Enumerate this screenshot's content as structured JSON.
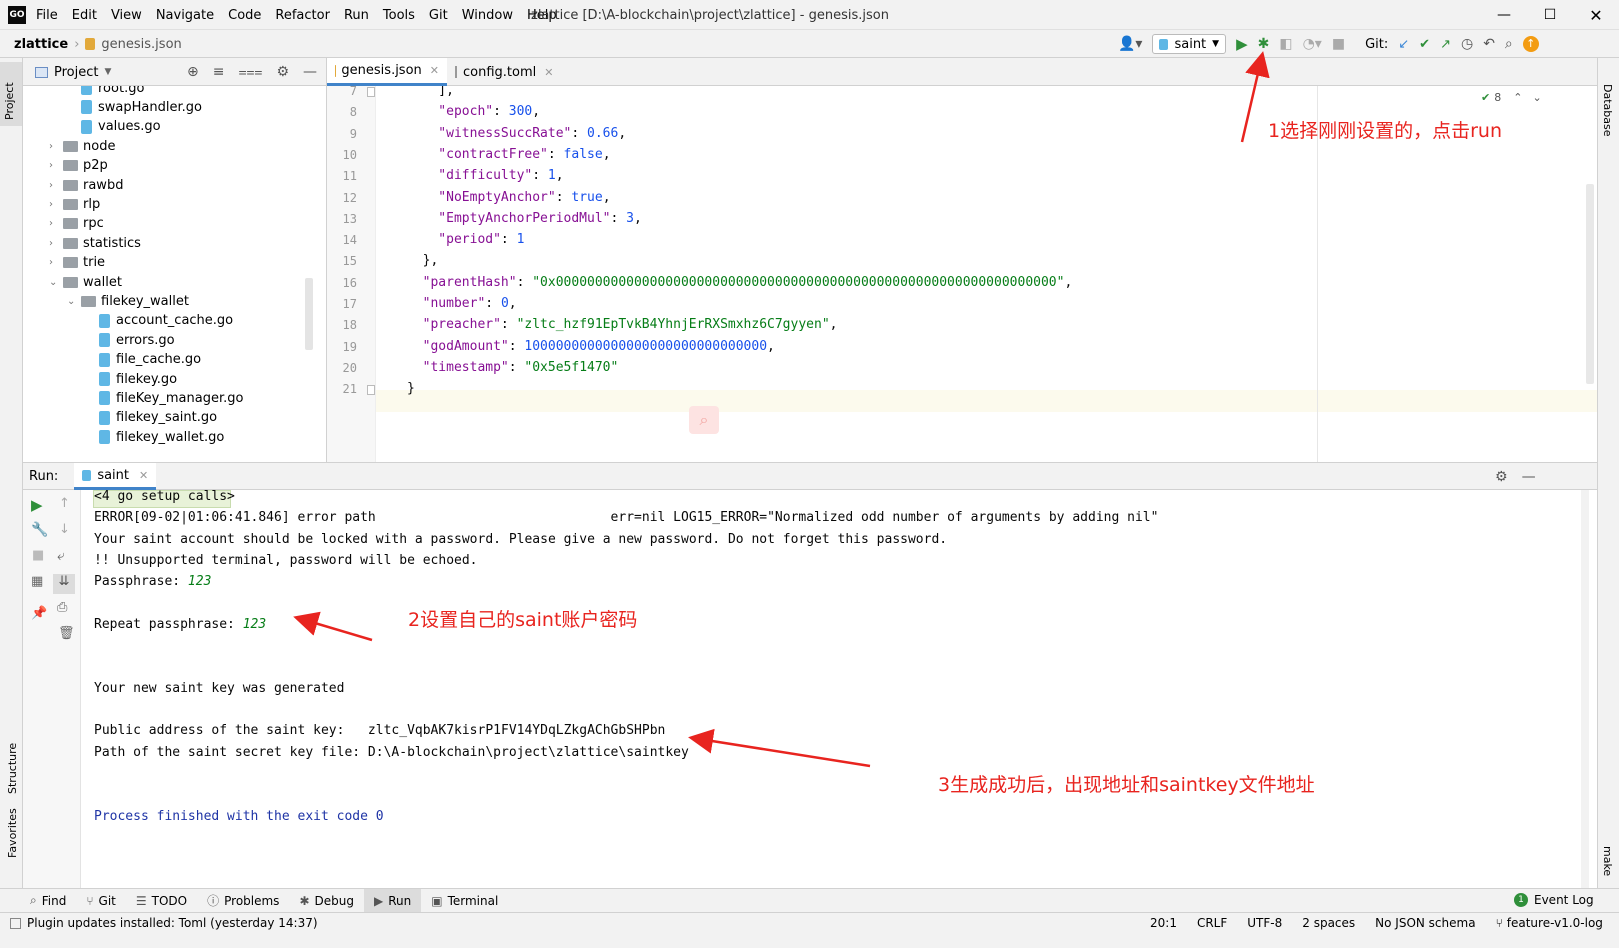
{
  "app_logo": "GO",
  "menu": [
    "File",
    "Edit",
    "View",
    "Navigate",
    "Code",
    "Refactor",
    "Run",
    "Tools",
    "Git",
    "Window",
    "Help"
  ],
  "window_title": "zlattice [D:\\A-blockchain\\project\\zlattice] - genesis.json",
  "breadcrumb": {
    "project": "zlattice",
    "file": "genesis.json"
  },
  "run_config": "saint",
  "git_label": "Git:",
  "project_panel": {
    "title": "Project",
    "items": [
      {
        "label": "root.go",
        "type": "file",
        "depth": 2
      },
      {
        "label": "swapHandler.go",
        "type": "file",
        "depth": 2
      },
      {
        "label": "values.go",
        "type": "file",
        "depth": 2
      },
      {
        "label": "node",
        "type": "folder",
        "depth": 1
      },
      {
        "label": "p2p",
        "type": "folder",
        "depth": 1
      },
      {
        "label": "rawbd",
        "type": "folder",
        "depth": 1
      },
      {
        "label": "rlp",
        "type": "folder",
        "depth": 1
      },
      {
        "label": "rpc",
        "type": "folder",
        "depth": 1
      },
      {
        "label": "statistics",
        "type": "folder",
        "depth": 1
      },
      {
        "label": "trie",
        "type": "folder",
        "depth": 1
      },
      {
        "label": "wallet",
        "type": "folder-open",
        "depth": 1
      },
      {
        "label": "filekey_wallet",
        "type": "folder-open",
        "depth": 2
      },
      {
        "label": "account_cache.go",
        "type": "file",
        "depth": 3
      },
      {
        "label": "errors.go",
        "type": "file",
        "depth": 3
      },
      {
        "label": "file_cache.go",
        "type": "file",
        "depth": 3
      },
      {
        "label": "filekey.go",
        "type": "file",
        "depth": 3
      },
      {
        "label": "fileKey_manager.go",
        "type": "file",
        "depth": 3
      },
      {
        "label": "filekey_saint.go",
        "type": "file",
        "depth": 3
      },
      {
        "label": "filekey_wallet.go",
        "type": "file",
        "depth": 3
      }
    ]
  },
  "editor_tabs": [
    {
      "label": "genesis.json",
      "active": true
    },
    {
      "label": "config.toml",
      "active": false
    }
  ],
  "inspection_count": "8",
  "code_lines": [
    {
      "n": "7",
      "parts": [
        [
          "p",
          "    ],"
        ]
      ]
    },
    {
      "n": "8",
      "parts": [
        [
          "k",
          "    \"epoch\""
        ],
        [
          "p",
          ": "
        ],
        [
          "n",
          "300"
        ],
        [
          "p",
          ","
        ]
      ]
    },
    {
      "n": "9",
      "parts": [
        [
          "k",
          "    \"witnessSuccRate\""
        ],
        [
          "p",
          ": "
        ],
        [
          "n",
          "0.66"
        ],
        [
          "p",
          ","
        ]
      ]
    },
    {
      "n": "10",
      "parts": [
        [
          "k",
          "    \"contractFree\""
        ],
        [
          "p",
          ": "
        ],
        [
          "n",
          "false"
        ],
        [
          "p",
          ","
        ]
      ]
    },
    {
      "n": "11",
      "parts": [
        [
          "k",
          "    \"difficulty\""
        ],
        [
          "p",
          ": "
        ],
        [
          "n",
          "1"
        ],
        [
          "p",
          ","
        ]
      ]
    },
    {
      "n": "12",
      "parts": [
        [
          "k",
          "    \"NoEmptyAnchor\""
        ],
        [
          "p",
          ": "
        ],
        [
          "n",
          "true"
        ],
        [
          "p",
          ","
        ]
      ]
    },
    {
      "n": "13",
      "parts": [
        [
          "k",
          "    \"EmptyAnchorPeriodMul\""
        ],
        [
          "p",
          ": "
        ],
        [
          "n",
          "3"
        ],
        [
          "p",
          ","
        ]
      ]
    },
    {
      "n": "14",
      "parts": [
        [
          "k",
          "    \"period\""
        ],
        [
          "p",
          ": "
        ],
        [
          "n",
          "1"
        ]
      ]
    },
    {
      "n": "15",
      "parts": [
        [
          "p",
          "  },"
        ]
      ]
    },
    {
      "n": "16",
      "parts": [
        [
          "k",
          "  \"parentHash\""
        ],
        [
          "p",
          ": "
        ],
        [
          "s",
          "\"0x0000000000000000000000000000000000000000000000000000000000000000\""
        ],
        [
          "p",
          ","
        ]
      ]
    },
    {
      "n": "17",
      "parts": [
        [
          "k",
          "  \"number\""
        ],
        [
          "p",
          ": "
        ],
        [
          "n",
          "0"
        ],
        [
          "p",
          ","
        ]
      ]
    },
    {
      "n": "18",
      "parts": [
        [
          "k",
          "  \"preacher\""
        ],
        [
          "p",
          ": "
        ],
        [
          "s",
          "\"zltc_hzf91EpTvkB4YhnjErRXSmxhz6C7gyyen\""
        ],
        [
          "p",
          ","
        ]
      ]
    },
    {
      "n": "19",
      "parts": [
        [
          "k",
          "  \"godAmount\""
        ],
        [
          "p",
          ": "
        ],
        [
          "n",
          "1000000000000000000000000000000"
        ],
        [
          "p",
          ","
        ]
      ]
    },
    {
      "n": "20",
      "parts": [
        [
          "k",
          "  \"timestamp\""
        ],
        [
          "p",
          ": "
        ],
        [
          "s",
          "\"0x5e5f1470\""
        ]
      ]
    },
    {
      "n": "21",
      "parts": [
        [
          "p",
          "}"
        ]
      ]
    }
  ],
  "run_panel": {
    "label": "Run:",
    "tab": "saint"
  },
  "console_lines": [
    {
      "text": "<4 go setup calls>",
      "style": "setup"
    },
    {
      "text": "ERROR[09-02|01:06:41.846] error path                              err=nil LOG15_ERROR=\"Normalized odd number of arguments by adding nil\"",
      "style": "normal"
    },
    {
      "text": "Your saint account should be locked with a password. Please give a new password. Do not forget this password.",
      "style": "normal"
    },
    {
      "text": "!! Unsupported terminal, password will be echoed.",
      "style": "normal"
    },
    {
      "text": "Passphrase: ",
      "input": "123",
      "style": "normal"
    },
    {
      "text": "",
      "style": "normal"
    },
    {
      "text": "Repeat passphrase: ",
      "input": "123",
      "style": "normal"
    },
    {
      "text": "",
      "style": "normal"
    },
    {
      "text": "",
      "style": "normal"
    },
    {
      "text": "Your new saint key was generated",
      "style": "normal"
    },
    {
      "text": "",
      "style": "normal"
    },
    {
      "text": "Public address of the saint key:   zltc_VqbAK7kisrP1FV14YDqLZkgAChGbSHPbn",
      "style": "normal"
    },
    {
      "text": "Path of the saint secret key file: D:\\A-blockchain\\project\\zlattice\\saintkey",
      "style": "normal"
    },
    {
      "text": "",
      "style": "normal"
    },
    {
      "text": "",
      "style": "normal"
    },
    {
      "text": "Process finished with the exit code 0",
      "style": "exit"
    }
  ],
  "annotations": {
    "a1": "1选择刚刚设置的，点击run",
    "a2": "2设置自己的saint账户密码",
    "a3": "3生成成功后，出现地址和saintkey文件地址"
  },
  "left_strip": {
    "project": "Project",
    "structure": "Structure",
    "favorites": "Favorites"
  },
  "right_strip": {
    "database": "Database",
    "make": "make"
  },
  "bottom_tools": [
    {
      "label": "Find",
      "icon": "search-icon"
    },
    {
      "label": "Git",
      "icon": "branch-icon"
    },
    {
      "label": "TODO",
      "icon": "list-icon"
    },
    {
      "label": "Problems",
      "icon": "info-icon"
    },
    {
      "label": "Debug",
      "icon": "bug-icon"
    },
    {
      "label": "Run",
      "icon": "play-icon"
    },
    {
      "label": "Terminal",
      "icon": "terminal-icon"
    }
  ],
  "event_log": {
    "count": "1",
    "label": "Event Log"
  },
  "status": {
    "message": "Plugin updates installed: Toml (yesterday 14:37)",
    "position": "20:1",
    "line_sep": "CRLF",
    "encoding": "UTF-8",
    "indent": "2 spaces",
    "schema": "No JSON schema",
    "branch": "feature-v1.0-log"
  },
  "colors": {
    "accent": "#2f8f3a",
    "annotation": "#e8241f",
    "keyword": "#871094",
    "number": "#1750eb",
    "string": "#067d17",
    "exit": "#1f34a6"
  }
}
